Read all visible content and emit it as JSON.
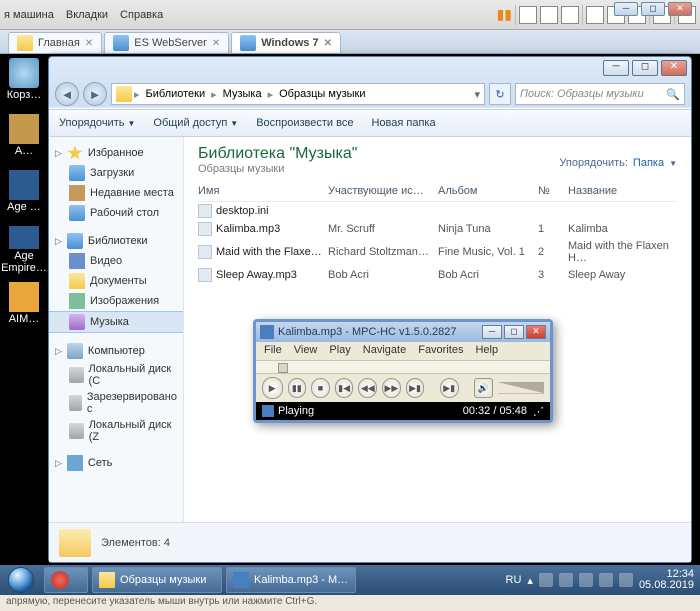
{
  "host": {
    "menus": [
      "я машина",
      "Вкладки",
      "Справка"
    ]
  },
  "tabs": [
    {
      "label": "Главная",
      "active": false
    },
    {
      "label": "ES WebServer",
      "active": false
    },
    {
      "label": "Windows 7",
      "active": true
    }
  ],
  "desktop_icons": [
    {
      "label": "Корз…"
    },
    {
      "label": "A…"
    },
    {
      "label": "Age …"
    },
    {
      "label": "Age Empire…"
    },
    {
      "label": "AIM…"
    }
  ],
  "explorer": {
    "breadcrumb": [
      "Библиотеки",
      "Музыка",
      "Образцы музыки"
    ],
    "search_placeholder": "Поиск: Образцы музыки",
    "toolbar": {
      "organize": "Упорядочить",
      "share": "Общий доступ",
      "play": "Воспроизвести все",
      "newfolder": "Новая папка"
    },
    "nav": {
      "fav": {
        "head": "Избранное",
        "items": [
          "Загрузки",
          "Недавние места",
          "Рабочий стол"
        ]
      },
      "lib": {
        "head": "Библиотеки",
        "items": [
          "Видео",
          "Документы",
          "Изображения",
          "Музыка"
        ],
        "sel": 3
      },
      "pc": {
        "head": "Компьютер",
        "items": [
          "Локальный диск (C",
          "Зарезервировано с",
          "Локальный диск (Z"
        ]
      },
      "net": {
        "head": "Сеть"
      }
    },
    "library": {
      "title": "Библиотека \"Музыка\"",
      "subtitle": "Образцы музыки",
      "arrange_label": "Упорядочить:",
      "arrange_value": "Папка"
    },
    "columns": {
      "name": "Имя",
      "artist": "Участвующие ис…",
      "album": "Альбом",
      "no": "№",
      "title": "Название"
    },
    "files": [
      {
        "name": "desktop.ini",
        "artist": "",
        "album": "",
        "no": "",
        "title": ""
      },
      {
        "name": "Kalimba.mp3",
        "artist": "Mr. Scruff",
        "album": "Ninja Tuna",
        "no": "1",
        "title": "Kalimba"
      },
      {
        "name": "Maid with the Flaxe…",
        "artist": "Richard Stoltzman…",
        "album": "Fine Music, Vol. 1",
        "no": "2",
        "title": "Maid with the Flaxen H…"
      },
      {
        "name": "Sleep Away.mp3",
        "artist": "Bob Acri",
        "album": "Bob Acri",
        "no": "3",
        "title": "Sleep Away"
      }
    ],
    "status": {
      "label": "Элементов: 4"
    }
  },
  "mpc": {
    "title": "Kalimba.mp3 - MPC-HC v1.5.0.2827",
    "menu": [
      "File",
      "View",
      "Play",
      "Navigate",
      "Favorites",
      "Help"
    ],
    "status": "Playing",
    "time": "00:32 / 05:48"
  },
  "taskbar": {
    "apps": [
      {
        "label": "Образцы музыки"
      },
      {
        "label": "Kalimba.mp3 - M…"
      }
    ],
    "lang": "RU",
    "time": "12:34",
    "date": "05.08.2019"
  },
  "bottom_hint": "апрямую, перенесите указатель мыши внутрь или нажмите Ctrl+G."
}
